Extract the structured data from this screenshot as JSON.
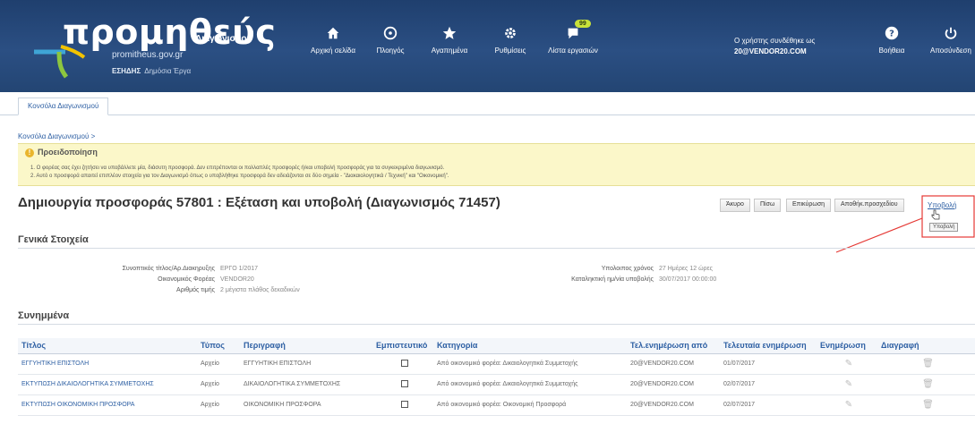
{
  "header": {
    "brand": "προμηθεύς",
    "brand_sub": "Διαγωνισμοί",
    "url": "promitheus.gov.gr",
    "org": "ΕΣΗΔΗΣ",
    "org_sub": "Δημόσια Έργα",
    "nav": [
      {
        "label": "Αρχική σελίδα",
        "icon": "home-icon"
      },
      {
        "label": "Πλοηγός",
        "icon": "compass-icon"
      },
      {
        "label": "Αγαπημένα",
        "icon": "star-icon"
      },
      {
        "label": "Ρυθμίσεις",
        "icon": "gear-icon"
      },
      {
        "label": "Λίστα εργασιών",
        "icon": "tasks-icon",
        "badge": "99"
      },
      {
        "label": "Βοήθεια",
        "icon": "help-icon"
      },
      {
        "label": "Αποσύνδεση",
        "icon": "power-icon"
      }
    ],
    "user_line1": "Ο χρήστης συνδέθηκε ως",
    "user_line2": "20@VENDOR20.COM"
  },
  "tab": "Κονσόλα Διαγωνισμού",
  "breadcrumb": "Κονσόλα Διαγωνισμού  >",
  "warning": {
    "title": "Προειδοποίηση",
    "line1": "1. Ο φορέας σας έχει ζητήσει να υποβάλλετε μία, διάσυτη προσφορά. Δεν επιτρέπονται οι πολλαπλές προσφορές ή/και υποβολή προσφοράς για τα συγκεκριμένα διαγωνισμό.",
    "line2": "2. Αυτό ο προσφορά απαιτεί επιπλέον στοιχεία για τον Διαγωνισμό όπως ο υποβλήθηκε προσφορά δεν αδειάζονται σε δύο σημεία - \"Διακαιολογητικά / Τεχνική\" και \"Οικονομική\"."
  },
  "page_title": "Δημιουργία προσφοράς 57801 : Εξέταση και υποβολή (Διαγωνισμός 71457)",
  "actions": {
    "cancel": "Άκυρο",
    "back": "Πίσω",
    "review": "Επικύρωση",
    "save": "Αποθήκ.προσχεδίου",
    "submit": "Υποβολή",
    "tooltip": "Υποβολή"
  },
  "general": {
    "title": "Γενικά Στοιχεία",
    "left": [
      {
        "label": "Συνοπτικός τίτλος/Αρ.Διακηρυξης",
        "value": "ΕΡΓΟ 1/2017"
      },
      {
        "label": "Οικονομικός Φορέας",
        "value": "VENDOR20"
      },
      {
        "label": "Αριθμός τιμής",
        "value": "2 μέγιστα πλάθος δεκαδικών"
      }
    ],
    "right": [
      {
        "label": "Υπολοιπος χρόνος",
        "value": "27 Ημέρες  12 ώρες"
      },
      {
        "label": "Καταληκτική ημ/νία υποβολής",
        "value": "30/07/2017 00:00:00"
      }
    ]
  },
  "attachments": {
    "title": "Συνημμένα",
    "columns": [
      "Τίτλος",
      "Τύπος",
      "Περιγραφή",
      "Εμπιστευτικό",
      "Κατηγορία",
      "Τελ.ενημέρωση από",
      "Τελευταία ενημέρωση",
      "Ενημέρωση",
      "Διαγραφή"
    ],
    "rows": [
      {
        "title": "ΕΓΓΥΗΤΙΚΗ ΕΠΙΣΤΟΛΗ",
        "type": "Αρχείο",
        "desc": "ΕΓΓΥΗΤΙΚΗ ΕΠΙΣΤΟΛΗ",
        "cat": "Από οικονομικό φορέα: Δικαιολογητικά Συμμετοχής",
        "by": "20@VENDOR20.COM",
        "date": "01/07/2017"
      },
      {
        "title": "ΕΚΤΥΠΩΣΗ ΔΙΚΑΙΟΛΟΓΗΤΙΚΑ ΣΥΜΜΕΤΟΧΗΣ",
        "type": "Αρχείο",
        "desc": "ΔΙΚΑΙΟΛΟΓΗΤΙΚΑ ΣΥΜΜΕΤΟΧΗΣ",
        "cat": "Από οικονομικό φορέα: Δικαιολογητικά Συμμετοχής",
        "by": "20@VENDOR20.COM",
        "date": "02/07/2017"
      },
      {
        "title": "ΕΚΤΥΠΩΣΗ ΟΙΚΟΝΟΜΙΚΗ ΠΡΟΣΦΟΡΑ",
        "type": "Αρχείο",
        "desc": "ΟΙΚΟΝΟΜΙΚΗ ΠΡΟΣΦΟΡΑ",
        "cat": "Από οικονομικό φορέα: Οικονομική Προσφορά",
        "by": "20@VENDOR20.COM",
        "date": "02/07/2017"
      }
    ]
  },
  "colors": {
    "header": "#2b4f83",
    "warning_bg": "#fbf7c9",
    "link": "#2d5fa3",
    "annotation": "#e53935"
  }
}
